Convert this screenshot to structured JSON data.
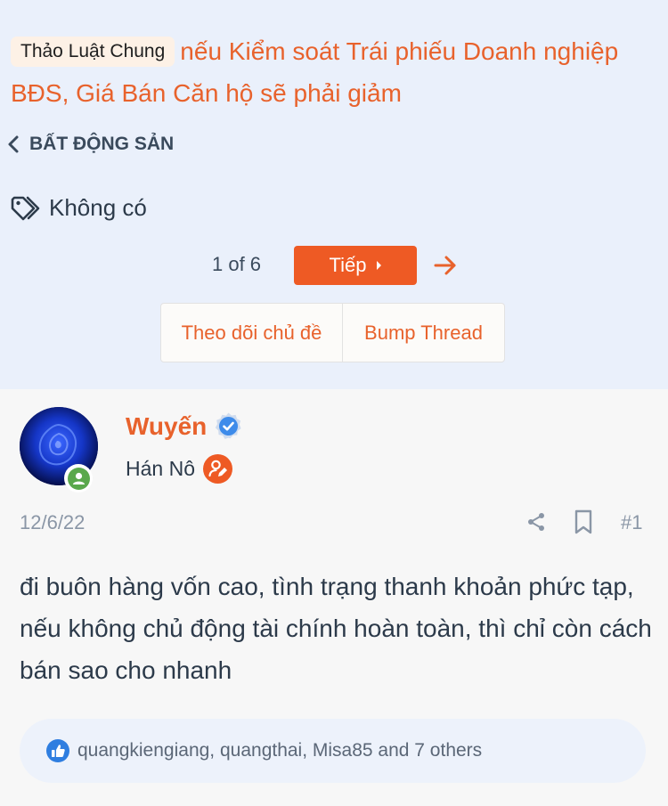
{
  "thread": {
    "prefix": "Thảo Luật Chung",
    "title": "nếu Kiểm soát Trái phiếu Doanh nghiệp BĐS, Giá Bán Căn hộ sẽ phải giảm"
  },
  "breadcrumb": {
    "label": "BẤT ĐỘNG SẢN"
  },
  "tags": {
    "label": "Không có",
    "icon": "tag-icon"
  },
  "pagination": {
    "current": "1 of 6",
    "next_label": "Tiếp"
  },
  "actions": {
    "watch_label": "Theo dõi chủ đề",
    "bump_label": "Bump Thread"
  },
  "post": {
    "author": "Wuyến",
    "role": "Hán Nô",
    "date": "12/6/22",
    "number": "#1",
    "body": "đi buôn hàng vốn cao, tình trạng thanh khoản phức tạp, nếu không chủ động tài chính hoàn toàn, thì chỉ còn cách bán sao cho nhanh",
    "reactions": "quangkiengiang, quangthai, Misa85 and 7 others"
  },
  "colors": {
    "accent": "#e8622c",
    "button": "#ee5a24",
    "header_bg": "#eaf0fb",
    "text": "#2c3a4a",
    "muted": "#8a96a6",
    "verified": "#3d8bea",
    "online": "#5aa84c"
  }
}
